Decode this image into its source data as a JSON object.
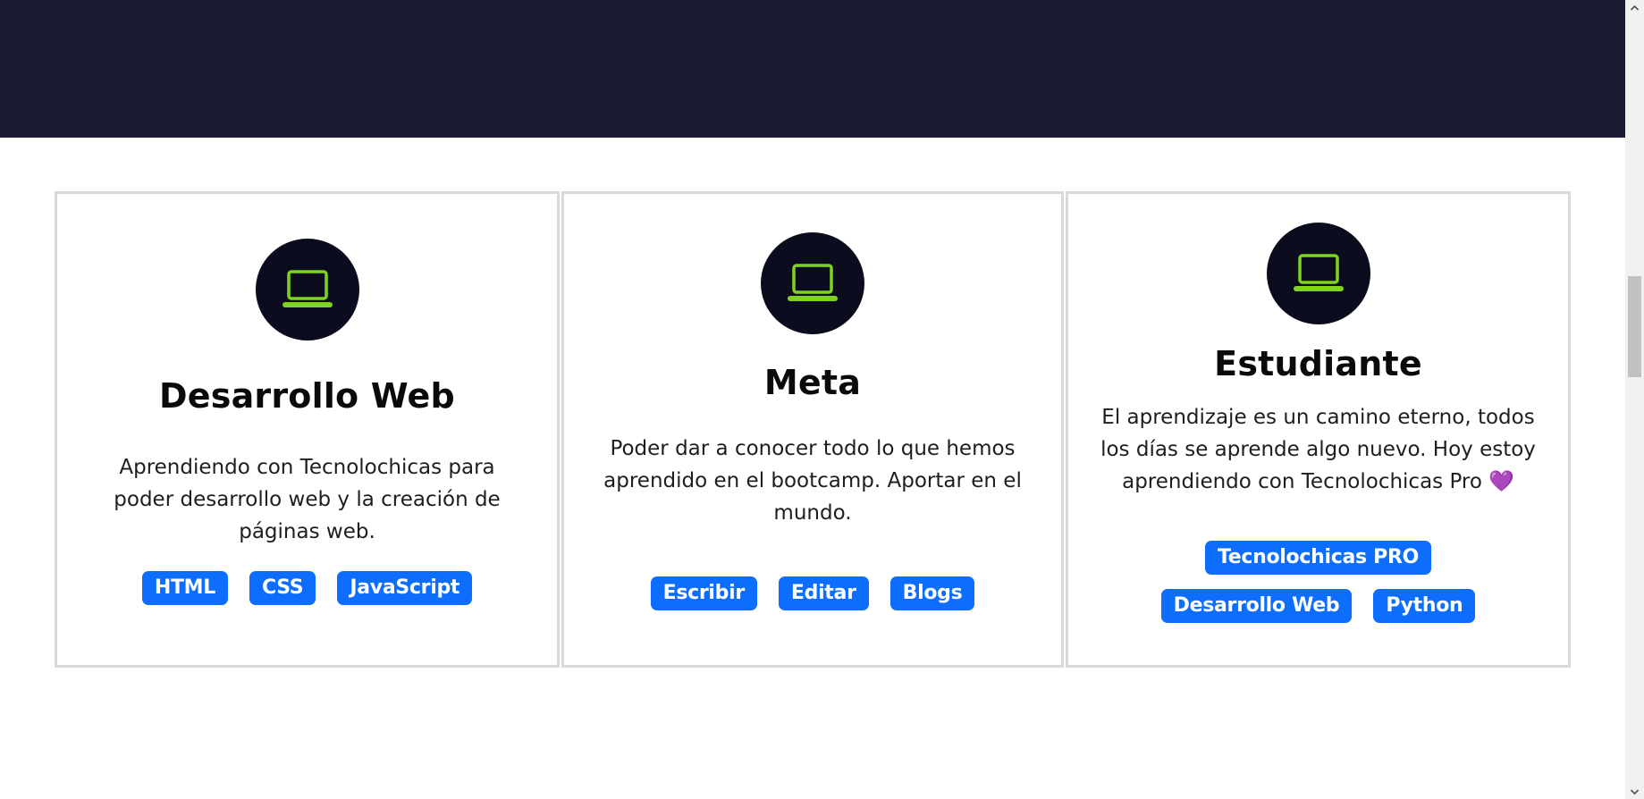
{
  "colors": {
    "banner": "#1b1c33",
    "icon_circle": "#0b0c1e",
    "icon_green": "#7ed321",
    "tag_blue": "#0d6efd",
    "card_border": "#d9d9d9"
  },
  "cards": [
    {
      "icon": "laptop-icon",
      "title": "Desarrollo Web",
      "text": "Aprendiendo con Tecnolochicas para poder desarrollo web y la creación de páginas web.",
      "tags": [
        "HTML",
        "CSS",
        "JavaScript"
      ]
    },
    {
      "icon": "laptop-icon",
      "title": "Meta",
      "text": "Poder dar a conocer todo lo que hemos aprendido en el bootcamp. Aportar en el mundo.",
      "tags": [
        "Escribir",
        "Editar",
        "Blogs"
      ]
    },
    {
      "icon": "laptop-icon",
      "title": "Estudiante",
      "text": "El aprendizaje es un camino eterno, todos los días se aprende algo nuevo. Hoy estoy aprendiendo con Tecnolochicas Pro",
      "emoji": "💜",
      "tags": [
        "Tecnolochicas PRO",
        "Desarrollo Web",
        "Python"
      ]
    }
  ],
  "scrollbar": {
    "up_icon": "scroll-up-arrow-icon",
    "down_icon": "scroll-down-arrow-icon"
  }
}
